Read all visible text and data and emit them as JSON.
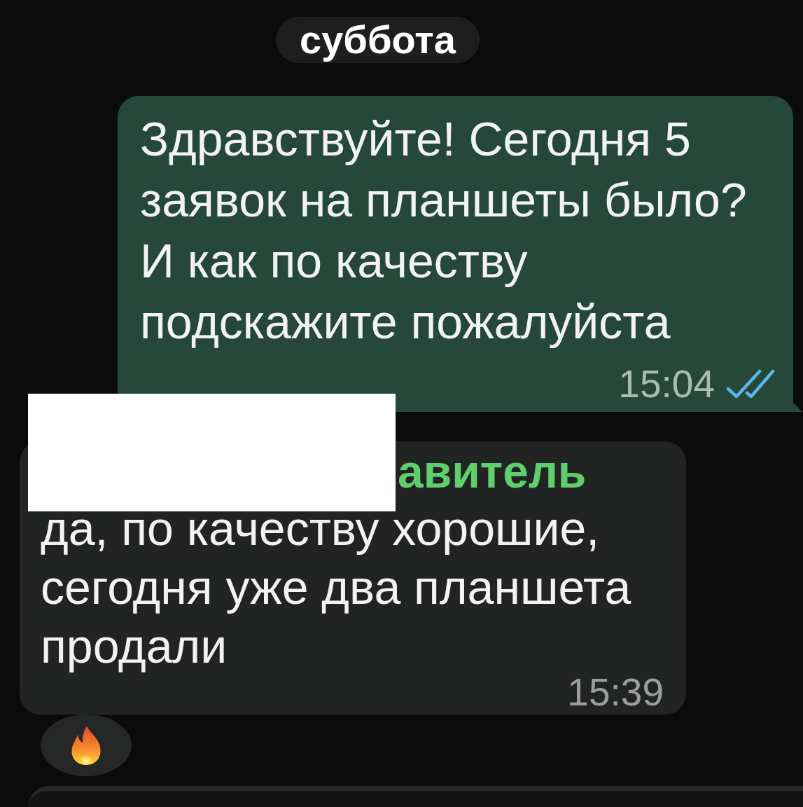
{
  "date_divider": {
    "label": "суббота"
  },
  "messages": [
    {
      "kind": "outgoing",
      "text": "Здравствуйте! Сегодня 5 заявок на планшеты было? И как по качеству подскажите пожалуйста",
      "time": "15:04",
      "read": true
    },
    {
      "kind": "incoming",
      "sender": "авитель",
      "sender_redacted": true,
      "text": "да, по качеству хорошие, сегодня уже два планшета продали",
      "time": "15:39",
      "reactions": [
        {
          "kind": "fire"
        }
      ]
    }
  ]
}
